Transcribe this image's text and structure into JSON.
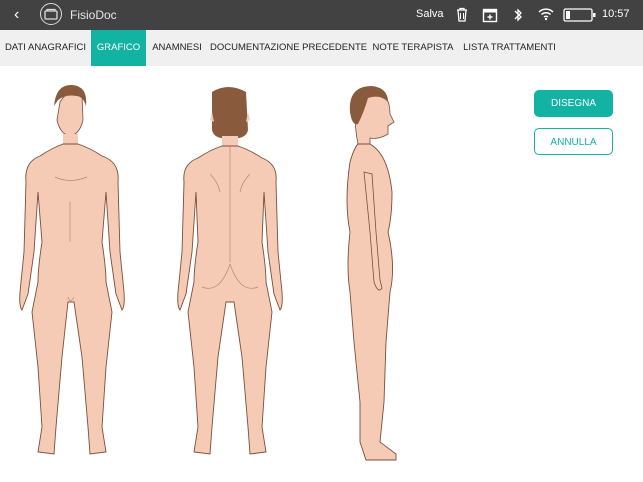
{
  "app": {
    "title": "FisioDoc",
    "save_label": "Salva",
    "time": "10:57"
  },
  "icons": [
    "back-chevron-icon",
    "app-logo-icon",
    "trash-icon",
    "calendar-add-icon",
    "bluetooth-icon",
    "wifi-icon",
    "battery-icon"
  ],
  "tabs": [
    {
      "label": "DATI ANAGRAFICI",
      "active": false
    },
    {
      "label": "GRAFICO",
      "active": true
    },
    {
      "label": "ANAMNESI",
      "active": false
    },
    {
      "label": "DOCUMENTAZIONE PRECEDENTE",
      "active": false
    },
    {
      "label": "NOTE TERAPISTA",
      "active": false
    },
    {
      "label": "LISTA TRATTAMENTI",
      "active": false
    }
  ],
  "actions": {
    "draw_label": "DISEGNA",
    "cancel_label": "ANNULLA"
  },
  "colors": {
    "accent": "#12b3a2",
    "topbar": "#424242",
    "tabbar": "#f0f0f0",
    "skin": "#f6cbb6",
    "hair": "#8a5a3c"
  }
}
